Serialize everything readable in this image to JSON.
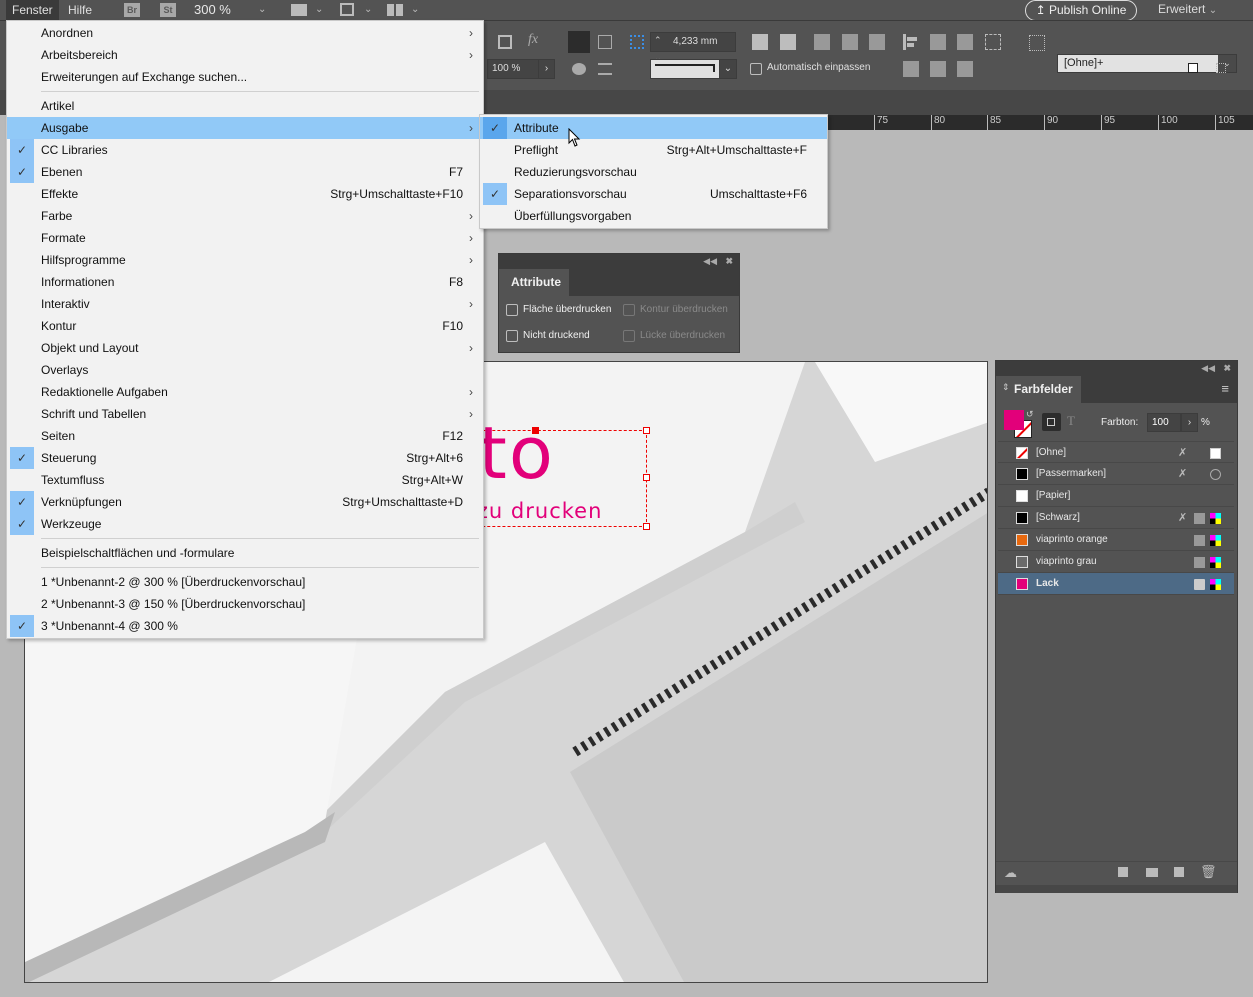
{
  "menubar": {
    "items": [
      "Fenster",
      "Hilfe"
    ],
    "bridge_badge": "Br",
    "stock_badge": "St",
    "zoom": "300 %",
    "publish_label": "Publish Online",
    "workspace": "Erweitert"
  },
  "control": {
    "opacity": "100 %",
    "stroke_weight": "4,233 mm",
    "auto_fit_label": "Automatisch einpassen",
    "object_style": "[Ohne]+"
  },
  "ruler": {
    "ticks": [
      "75",
      "80",
      "85",
      "90",
      "95",
      "100",
      "105"
    ]
  },
  "window_menu": {
    "sections": [
      [
        {
          "label": "Anordnen",
          "submenu": true
        },
        {
          "label": "Arbeitsbereich",
          "submenu": true
        },
        {
          "label": "Erweiterungen auf Exchange suchen..."
        }
      ],
      [
        {
          "label": "Artikel"
        },
        {
          "label": "Ausgabe",
          "submenu": true,
          "highlighted": true
        },
        {
          "label": "CC Libraries",
          "checked": true
        },
        {
          "label": "Ebenen",
          "checked": true,
          "shortcut": "F7"
        },
        {
          "label": "Effekte",
          "shortcut": "Strg+Umschalttaste+F10"
        },
        {
          "label": "Farbe",
          "submenu": true
        },
        {
          "label": "Formate",
          "submenu": true
        },
        {
          "label": "Hilfsprogramme",
          "submenu": true
        },
        {
          "label": "Informationen",
          "shortcut": "F8"
        },
        {
          "label": "Interaktiv",
          "submenu": true
        },
        {
          "label": "Kontur",
          "shortcut": "F10"
        },
        {
          "label": "Objekt und Layout",
          "submenu": true
        },
        {
          "label": "Overlays"
        },
        {
          "label": "Redaktionelle Aufgaben",
          "submenu": true
        },
        {
          "label": "Schrift und Tabellen",
          "submenu": true
        },
        {
          "label": "Seiten",
          "shortcut": "F12"
        },
        {
          "label": "Steuerung",
          "checked": true,
          "shortcut": "Strg+Alt+6"
        },
        {
          "label": "Textumfluss",
          "shortcut": "Strg+Alt+W"
        },
        {
          "label": "Verknüpfungen",
          "checked": true,
          "shortcut": "Strg+Umschalttaste+D"
        },
        {
          "label": "Werkzeuge",
          "checked": true
        }
      ],
      [
        {
          "label": "Beispielschaltflächen und -formulare"
        }
      ],
      [
        {
          "label": "1 *Unbenannt-2 @ 300 % [Überdruckenvorschau]"
        },
        {
          "label": "2 *Unbenannt-3 @ 150 % [Überdruckenvorschau]"
        },
        {
          "label": "3 *Unbenannt-4 @ 300 %",
          "checked": true
        }
      ]
    ]
  },
  "output_submenu": {
    "items": [
      {
        "label": "Attribute",
        "checked": true,
        "highlighted": true
      },
      {
        "label": "Preflight",
        "shortcut": "Strg+Alt+Umschalttaste+F"
      },
      {
        "label": "Reduzierungsvorschau"
      },
      {
        "label": "Separationsvorschau",
        "checked": true,
        "shortcut": "Umschalttaste+F6"
      },
      {
        "label": "Überfüllungsvorgaben"
      }
    ]
  },
  "attributes_panel": {
    "title": "Attribute",
    "options": [
      {
        "label": "Fläche überdrucken",
        "checked": false,
        "enabled": true
      },
      {
        "label": "Kontur überdrucken",
        "checked": false,
        "enabled": false
      },
      {
        "label": "Nicht druckend",
        "checked": false,
        "enabled": true
      },
      {
        "label": "Lücke überdrucken",
        "checked": false,
        "enabled": false
      }
    ]
  },
  "swatches_panel": {
    "title": "Farbfelder",
    "tint_label": "Farbton:",
    "tint_value": "100",
    "tint_unit": "%",
    "fill_color": "#e2007a",
    "swatches": [
      {
        "name": "[Ohne]",
        "color": "none",
        "locked": true
      },
      {
        "name": "[Passermarken]",
        "color": "#000000",
        "locked": true
      },
      {
        "name": "[Papier]",
        "color": "#ffffff"
      },
      {
        "name": "[Schwarz]",
        "color": "#000000",
        "locked": true
      },
      {
        "name": "viaprinto orange",
        "color": "#e8690f"
      },
      {
        "name": "viaprinto grau",
        "color": "#6b6b6b"
      },
      {
        "name": "Lack",
        "color": "#e2007a",
        "selected": true
      }
    ]
  },
  "canvas": {
    "logo_text": "nto",
    "tagline": "t zu drucken",
    "brand_color": "#e2007a"
  }
}
